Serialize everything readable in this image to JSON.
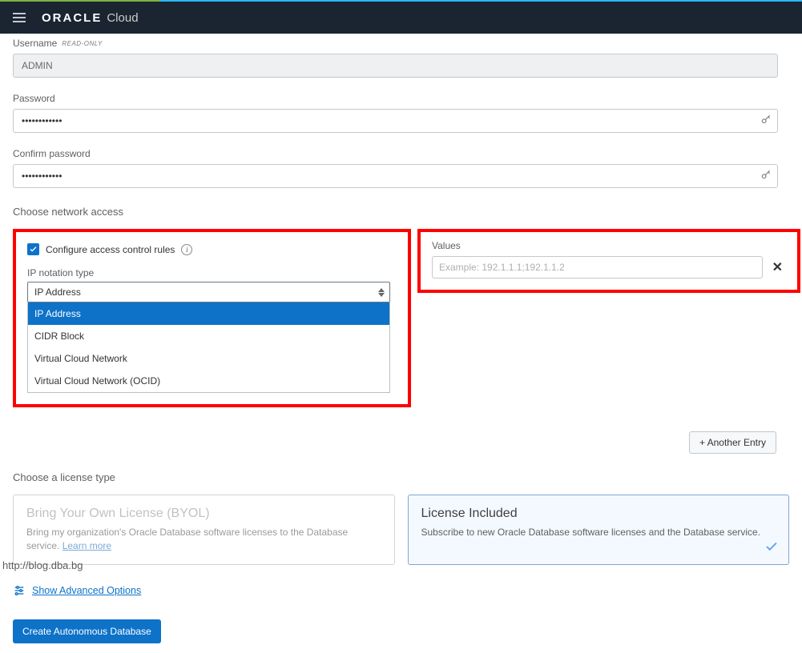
{
  "brand": {
    "name": "ORACLE",
    "suffix": "Cloud"
  },
  "fields": {
    "username": {
      "label": "Username",
      "badge": "READ-ONLY",
      "value": "ADMIN"
    },
    "password": {
      "label": "Password",
      "value": "••••••••••••"
    },
    "confirm": {
      "label": "Confirm password",
      "value": "••••••••••••"
    }
  },
  "network": {
    "section_label": "Choose network access",
    "acr_label": "Configure access control rules",
    "ip_type_label": "IP notation type",
    "ip_type_selected": "IP Address",
    "ip_type_options": [
      "IP Address",
      "CIDR Block",
      "Virtual Cloud Network",
      "Virtual Cloud Network (OCID)"
    ],
    "values_label": "Values",
    "values_placeholder": "Example: 192.1.1.1;192.1.1.2",
    "another_entry_label": "+ Another Entry"
  },
  "license": {
    "section_label": "Choose a license type",
    "byol": {
      "title": "Bring Your Own License (BYOL)",
      "sub": "Bring my organization's Oracle Database software licenses to the Database service.",
      "learn": "Learn more"
    },
    "included": {
      "title": "License Included",
      "sub": "Subscribe to new Oracle Database software licenses and the Database service."
    }
  },
  "advanced_label": "Show Advanced Options",
  "submit_label": "Create Autonomous Database",
  "watermark": "http://blog.dba.bg"
}
